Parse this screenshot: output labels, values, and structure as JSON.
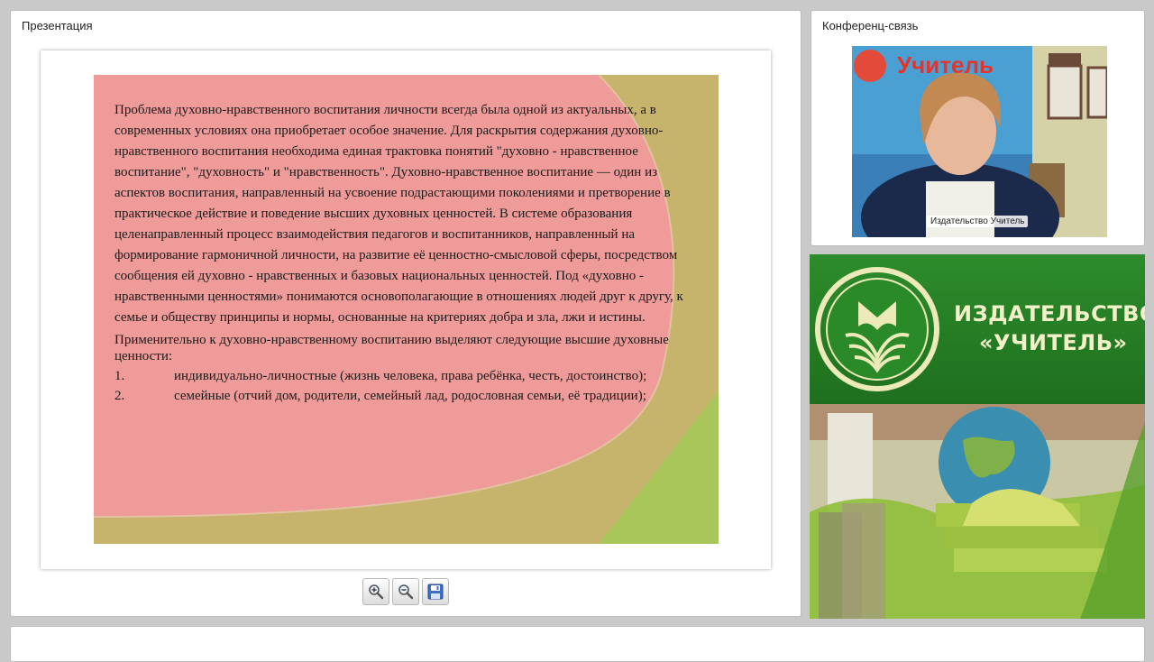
{
  "presentation_panel": {
    "title": "Презентация",
    "slide": {
      "paragraph1": "Проблема духовно-нравственного воспитания личности всегда была одной из актуальных, а в современных условиях она приобретает особое значение. Для раскрытия содержания духовно-нравственного воспитания необходима единая трактовка понятий \"духовно - нравственное воспитание\", \"духовность\" и \"нравственность\". Духовно-нравственное воспитание — один из аспектов воспитания, направленный на усвоение подрастающими поколениями и претворение в практическое действие и поведение высших духовных ценностей. В системе образования целенаправленный процесс взаимодействия педагогов и воспитанников, направленный на формирование гармоничной личности, на развитие её ценностно-смысловой сферы, посредством сообщения ей духовно - нравственных и базовых национальных ценностей. Под «духовно - нравственными ценностями» понимаются основополагающие в отношениях людей друг к другу, к семье и обществу принципы и нормы, основанные на критериях добра и зла, лжи и истины.",
      "paragraph2": "Применительно к духовно-нравственному воспитанию выделяют следующие высшие духовные ценности:",
      "list": [
        {
          "num": "1.",
          "text": "индивидуально-личностные (жизнь человека, права ребёнка, честь, достоинство);"
        },
        {
          "num": "2.",
          "text": "семейные (отчий дом, родители, семейный лад, родословная семьи, её традиции);"
        }
      ]
    },
    "toolbar": {
      "zoom_in_icon": "magnifier-plus-icon",
      "zoom_out_icon": "magnifier-minus-icon",
      "save_icon": "floppy-disk-icon"
    }
  },
  "conference_panel": {
    "title": "Конференц-связь",
    "video_caption": "Издательство Учитель",
    "banner_text": "Учитель"
  },
  "publisher_panel": {
    "name_line1": "ИЗДАТЕЛЬСТВО",
    "name_line2": "«УЧИТЕЛЬ»"
  },
  "colors": {
    "slide_pink": "#ee9b99",
    "slide_khaki": "#c6b46c",
    "slide_green": "#a9c65a",
    "publisher_green": "#2a8a27",
    "publisher_text": "#f2f0c8"
  }
}
